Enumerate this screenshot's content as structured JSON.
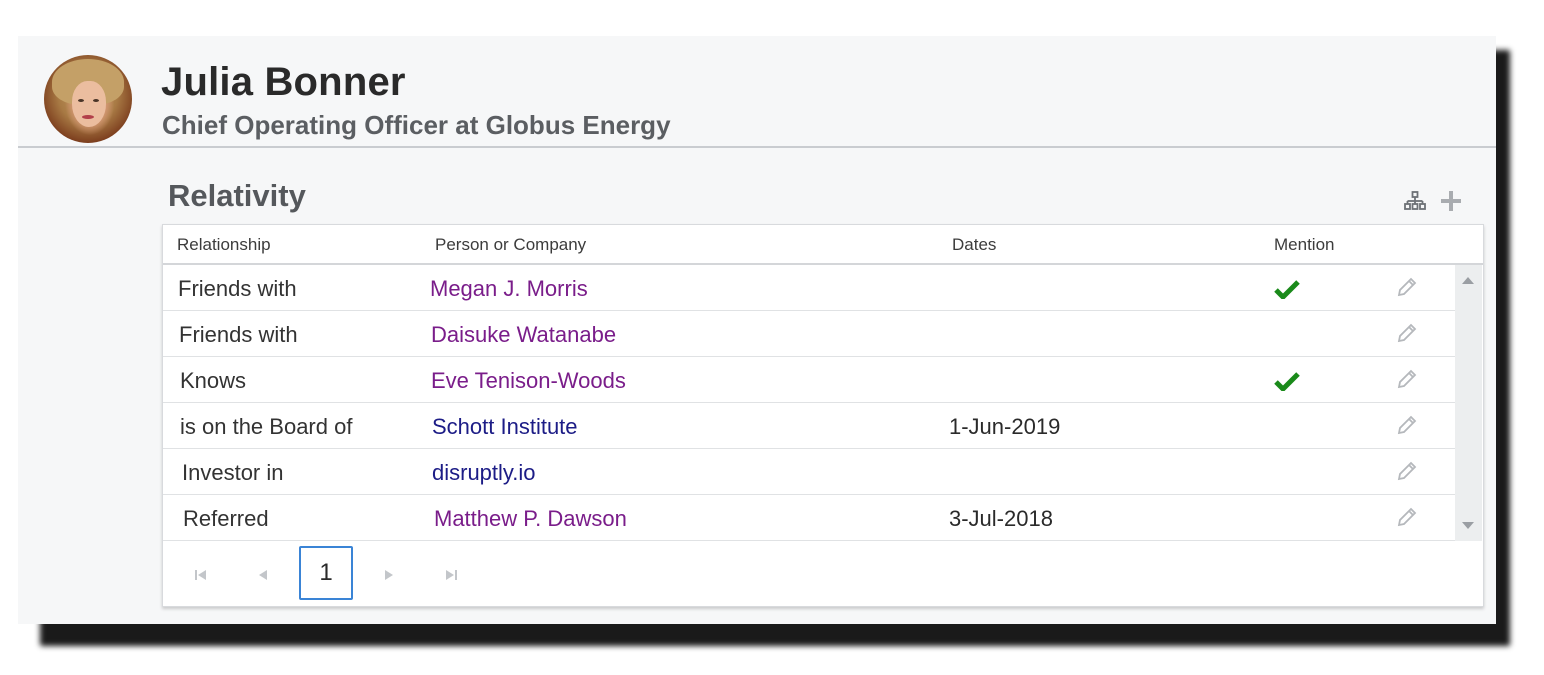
{
  "profile": {
    "name": "Julia Bonner",
    "title": "Chief Operating Officer at Globus Energy"
  },
  "section": {
    "title": "Relativity",
    "icons": [
      "org-chart-icon",
      "plus-icon"
    ]
  },
  "grid": {
    "columns": [
      "Relationship",
      "Person or Company",
      "Dates",
      "Mention"
    ],
    "rows": [
      {
        "relationship": "Friends with",
        "entity": "Megan J. Morris",
        "entity_type": "person",
        "date": "",
        "mention": true
      },
      {
        "relationship": "Friends with",
        "entity": "Daisuke Watanabe",
        "entity_type": "person",
        "date": "",
        "mention": false
      },
      {
        "relationship": "Knows",
        "entity": "Eve Tenison-Woods",
        "entity_type": "person",
        "date": "",
        "mention": true
      },
      {
        "relationship": "is on the Board of",
        "entity": "Schott Institute",
        "entity_type": "company",
        "date": "1-Jun-2019",
        "mention": false
      },
      {
        "relationship": "Investor in",
        "entity": "disruptly.io",
        "entity_type": "company",
        "date": "",
        "mention": false
      },
      {
        "relationship": "Referred",
        "entity": "Matthew P. Dawson",
        "entity_type": "person",
        "date": "3-Jul-2018",
        "mention": false
      }
    ]
  },
  "pager": {
    "current_page": "1",
    "icons": [
      "first-page-icon",
      "prev-page-icon",
      "next-page-icon",
      "last-page-icon"
    ]
  },
  "colors": {
    "person_link": "#7a1d8a",
    "company_link": "#1c1c86",
    "check": "#1a8a1a",
    "accent": "#3a84d6"
  }
}
